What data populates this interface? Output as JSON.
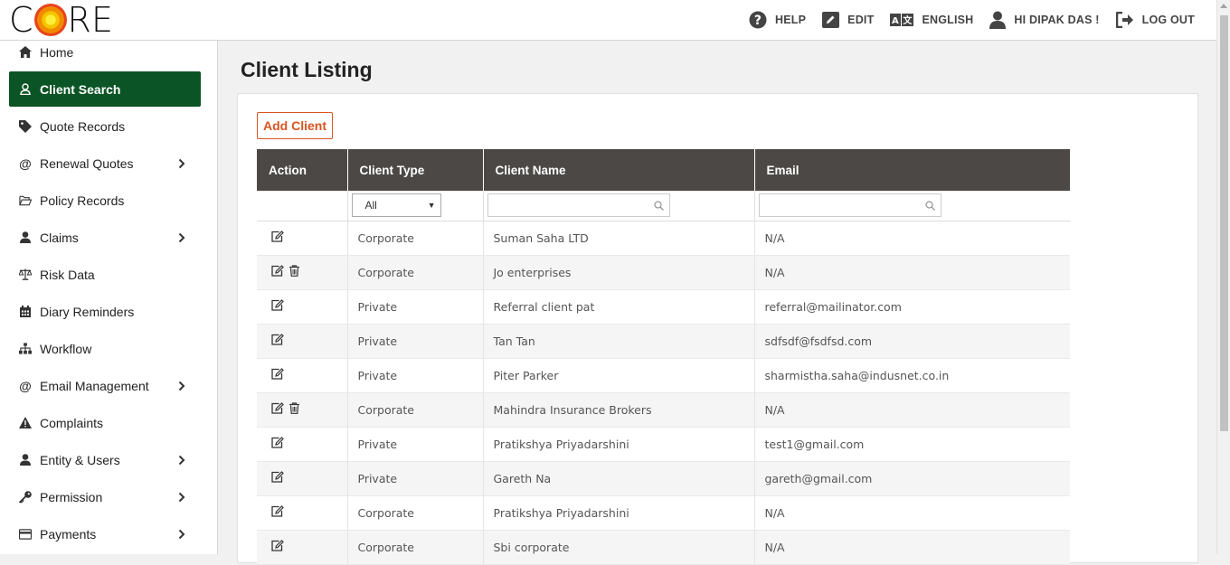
{
  "header": {
    "logo_text": "CORE",
    "nav": [
      {
        "label": "HELP",
        "icon": "help-icon"
      },
      {
        "label": "EDIT",
        "icon": "edit-icon"
      },
      {
        "label": "ENGLISH",
        "icon": "translate-icon"
      },
      {
        "label": "HI DIPAK DAS !",
        "icon": "user-icon"
      },
      {
        "label": "LOG OUT",
        "icon": "logout-icon"
      }
    ]
  },
  "sidebar": {
    "items": [
      {
        "label": "Home",
        "icon": "home-icon",
        "has_arrow": false,
        "active": false
      },
      {
        "label": "Client Search",
        "icon": "user-outline-icon",
        "has_arrow": false,
        "active": true
      },
      {
        "label": "Quote Records",
        "icon": "tag-icon",
        "has_arrow": false,
        "active": false
      },
      {
        "label": "Renewal Quotes",
        "icon": "at-icon",
        "has_arrow": true,
        "active": false
      },
      {
        "label": "Policy Records",
        "icon": "folder-open-icon",
        "has_arrow": false,
        "active": false
      },
      {
        "label": "Claims",
        "icon": "user-icon",
        "has_arrow": true,
        "active": false
      },
      {
        "label": "Risk Data",
        "icon": "scale-icon",
        "has_arrow": false,
        "active": false
      },
      {
        "label": "Diary Reminders",
        "icon": "calendar-icon",
        "has_arrow": false,
        "active": false
      },
      {
        "label": "Workflow",
        "icon": "sitemap-icon",
        "has_arrow": false,
        "active": false
      },
      {
        "label": "Email Management",
        "icon": "at-icon",
        "has_arrow": true,
        "active": false
      },
      {
        "label": "Complaints",
        "icon": "warning-icon",
        "has_arrow": false,
        "active": false
      },
      {
        "label": "Entity & Users",
        "icon": "user-icon",
        "has_arrow": true,
        "active": false
      },
      {
        "label": "Permission",
        "icon": "key-icon",
        "has_arrow": true,
        "active": false
      },
      {
        "label": "Payments",
        "icon": "credit-card-icon",
        "has_arrow": true,
        "active": false
      }
    ]
  },
  "main": {
    "title": "Client Listing",
    "add_button": "Add Client",
    "columns": [
      "Action",
      "Client Type",
      "Client Name",
      "Email"
    ],
    "filter": {
      "client_type_selected": "All"
    },
    "rows": [
      {
        "type": "Corporate",
        "name": "Suman Saha LTD",
        "email": "N/A",
        "deletable": false
      },
      {
        "type": "Corporate",
        "name": "Jo enterprises",
        "email": "N/A",
        "deletable": true
      },
      {
        "type": "Private",
        "name": "Referral client pat",
        "email": "referral@mailinator.com",
        "deletable": false
      },
      {
        "type": "Private",
        "name": "Tan Tan",
        "email": "sdfsdf@fsdfsd.com",
        "deletable": false
      },
      {
        "type": "Private",
        "name": "Piter Parker",
        "email": "sharmistha.saha@indusnet.co.in",
        "deletable": false
      },
      {
        "type": "Corporate",
        "name": "Mahindra Insurance Brokers",
        "email": "N/A",
        "deletable": true
      },
      {
        "type": "Private",
        "name": "Pratikshya Priyadarshini",
        "email": "test1@gmail.com",
        "deletable": false
      },
      {
        "type": "Private",
        "name": "Gareth Na",
        "email": "gareth@gmail.com",
        "deletable": false
      },
      {
        "type": "Corporate",
        "name": "Pratikshya Priyadarshini",
        "email": "N/A",
        "deletable": false
      },
      {
        "type": "Corporate",
        "name": "Sbi corporate",
        "email": "N/A",
        "deletable": false
      }
    ]
  },
  "colors": {
    "accent": "#0b5425",
    "header_bg": "#4b4845",
    "button": "#d9531e"
  }
}
